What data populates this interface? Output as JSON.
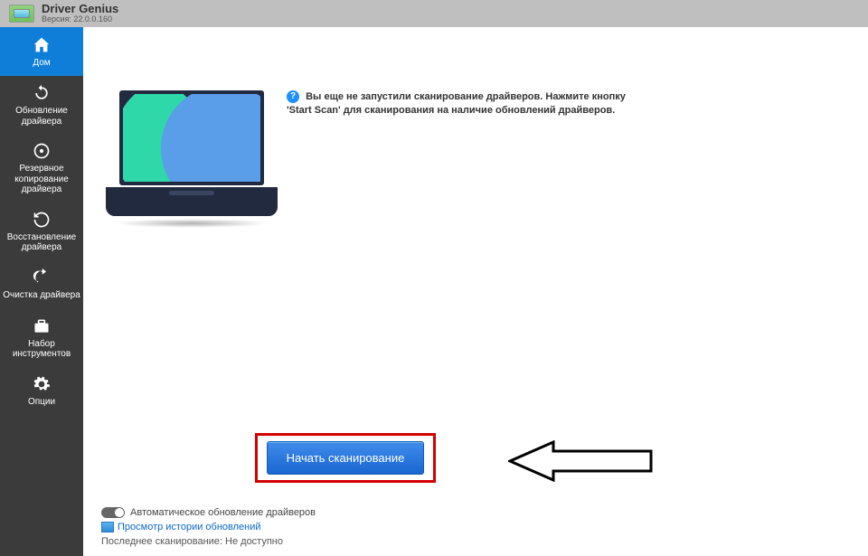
{
  "titlebar": {
    "app_name": "Driver Genius",
    "version_label": "Версия: 22.0.0.160"
  },
  "sidebar": {
    "items": [
      {
        "label": "Дом",
        "icon": "home-icon"
      },
      {
        "label": "Обновление драйвера",
        "icon": "refresh-icon"
      },
      {
        "label": "Резервное копирование драйвера",
        "icon": "disc-icon"
      },
      {
        "label": "Восстановление драйвера",
        "icon": "restore-icon"
      },
      {
        "label": "Очистка драйвера",
        "icon": "clean-icon"
      },
      {
        "label": "Набор инструментов",
        "icon": "toolbox-icon"
      },
      {
        "label": "Опции",
        "icon": "gear-icon"
      }
    ]
  },
  "main": {
    "info_line1": "Вы еще не запустили сканирование драйверов. Нажмите кнопку",
    "info_line2": "'Start Scan' для сканирования на наличие обновлений драйверов.",
    "scan_button_label": "Начать  сканирование",
    "auto_update_label": "Автоматическое обновление драйверов",
    "history_link": "Просмотр истории обновлений",
    "last_scan_label": "Последнее сканирование:",
    "last_scan_value": "Не доступно"
  }
}
